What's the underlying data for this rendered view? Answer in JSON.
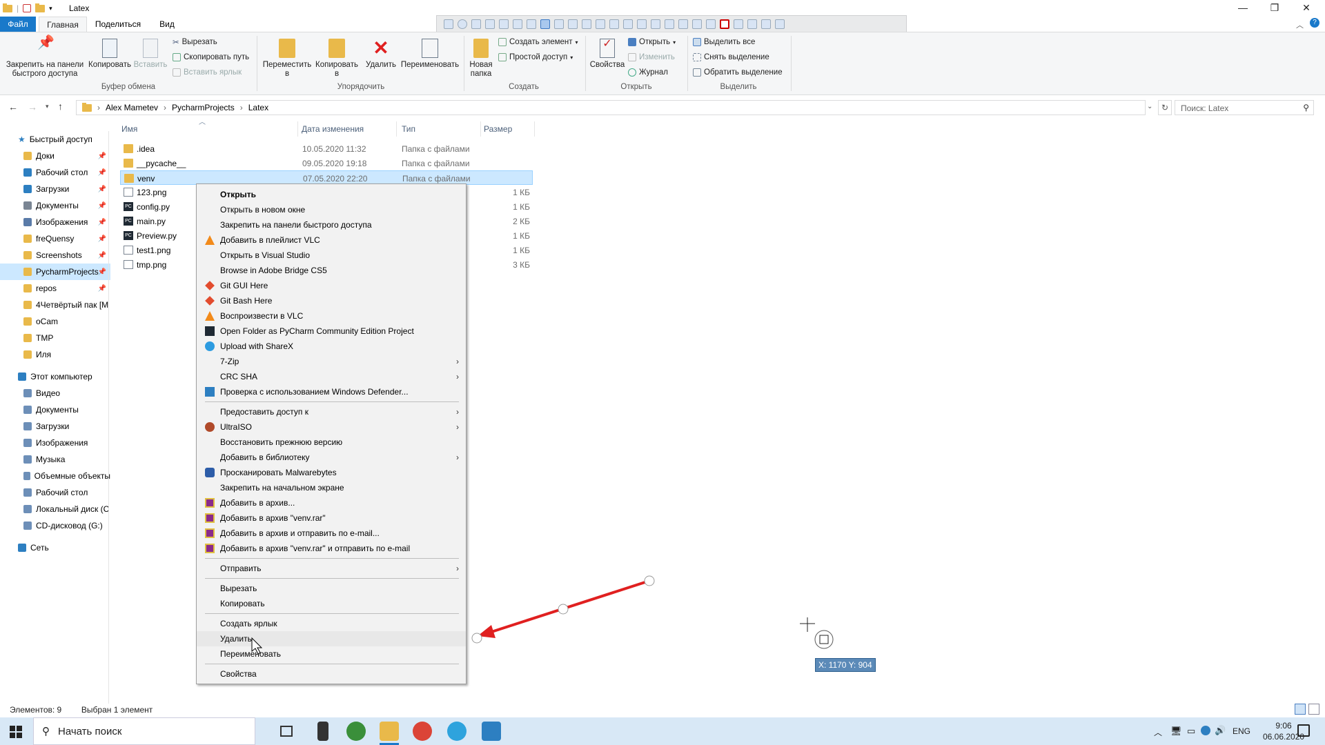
{
  "window": {
    "title": "Latex",
    "minimize": "—",
    "maximize": "❐",
    "close": "✕"
  },
  "ribbon_tabs": {
    "file": "Файл",
    "home": "Главная",
    "share": "Поделиться",
    "view": "Вид"
  },
  "ribbon": {
    "clipboard": {
      "pin": "Закрепить на панели быстрого доступа",
      "copy": "Копировать",
      "paste": "Вставить",
      "cut": "Вырезать",
      "copy_path": "Скопировать путь",
      "paste_shortcut": "Вставить ярлык",
      "group": "Буфер обмена"
    },
    "organize": {
      "move": "Переместить в",
      "copy_to": "Копировать в",
      "delete": "Удалить",
      "rename": "Переименовать",
      "group": "Упорядочить"
    },
    "create": {
      "new_folder": "Новая папка",
      "new_item": "Создать элемент",
      "easy_access": "Простой доступ",
      "group": "Создать"
    },
    "open": {
      "properties": "Свойства",
      "open": "Открыть",
      "edit": "Изменить",
      "history": "Журнал",
      "group": "Открыть"
    },
    "select": {
      "select_all": "Выделить все",
      "select_none": "Снять выделение",
      "invert": "Обратить выделение",
      "group": "Выделить"
    }
  },
  "address": {
    "crumbs": [
      "Alex Mametev",
      "PycharmProjects",
      "Latex"
    ],
    "search_placeholder": "Поиск: Latex"
  },
  "nav": {
    "quick_access": "Быстрый доступ",
    "pinned": [
      {
        "label": "Доки",
        "icon": "docs-icon"
      },
      {
        "label": "Рабочий стол",
        "icon": "desktop-icon"
      },
      {
        "label": "Загрузки",
        "icon": "download-icon"
      },
      {
        "label": "Документы",
        "icon": "documents-icon"
      },
      {
        "label": "Изображения",
        "icon": "pictures-icon"
      },
      {
        "label": "freQuensy",
        "icon": "folder-icon"
      },
      {
        "label": "Screenshots",
        "icon": "folder-icon"
      },
      {
        "label": "PycharmProjects",
        "icon": "folder-icon"
      },
      {
        "label": "repos",
        "icon": "folder-icon"
      }
    ],
    "recent": [
      "4Четвёртый пак [M",
      "oCam",
      "TMP",
      "Иля"
    ],
    "this_pc": "Этот компьютер",
    "pc_items": [
      "Видео",
      "Документы",
      "Загрузки",
      "Изображения",
      "Музыка",
      "Объемные объекты",
      "Рабочий стол",
      "Локальный диск (C",
      "CD-дисковод (G:)"
    ],
    "network": "Сеть"
  },
  "columns": {
    "name": "Имя",
    "date": "Дата изменения",
    "type": "Тип",
    "size": "Размер"
  },
  "files": [
    {
      "name": ".idea",
      "date": "10.05.2020 11:32",
      "type": "Папка с файлами",
      "size": "",
      "kind": "folder"
    },
    {
      "name": "__pycache__",
      "date": "09.05.2020 19:18",
      "type": "Папка с файлами",
      "size": "",
      "kind": "folder"
    },
    {
      "name": "venv",
      "date": "07.05.2020 22:20",
      "type": "Папка с файлами",
      "size": "",
      "kind": "folder"
    },
    {
      "name": "123.png",
      "date": "",
      "type": "",
      "size": "1 КБ",
      "kind": "png"
    },
    {
      "name": "config.py",
      "date": "",
      "type": "",
      "size": "1 КБ",
      "kind": "py"
    },
    {
      "name": "main.py",
      "date": "",
      "type": "",
      "size": "2 КБ",
      "kind": "py"
    },
    {
      "name": "Preview.py",
      "date": "",
      "type": "",
      "size": "1 КБ",
      "kind": "py"
    },
    {
      "name": "test1.png",
      "date": "",
      "type": "",
      "size": "1 КБ",
      "kind": "png"
    },
    {
      "name": "tmp.png",
      "date": "",
      "type": "",
      "size": "3 КБ",
      "kind": "png"
    }
  ],
  "context_menu": [
    {
      "label": "Открыть",
      "bold": true
    },
    {
      "label": "Открыть в новом окне"
    },
    {
      "label": "Закрепить на панели быстрого доступа"
    },
    {
      "label": "Добавить в плейлист VLC",
      "icon": "vlc-icon"
    },
    {
      "label": "Открыть в Visual Studio"
    },
    {
      "label": "Browse in Adobe Bridge CS5"
    },
    {
      "label": "Git GUI Here",
      "icon": "git-icon"
    },
    {
      "label": "Git Bash Here",
      "icon": "git-icon"
    },
    {
      "label": "Воспроизвести в VLC",
      "icon": "vlc-icon"
    },
    {
      "label": "Open Folder as PyCharm Community Edition Project",
      "icon": "pycharm-icon"
    },
    {
      "label": "Upload with ShareX",
      "icon": "sharex-icon"
    },
    {
      "label": "7-Zip",
      "sub": true
    },
    {
      "label": "CRC SHA",
      "sub": true
    },
    {
      "label": "Проверка с использованием Windows Defender...",
      "icon": "defender-icon"
    },
    {
      "sep": true
    },
    {
      "label": "Предоставить доступ к",
      "sub": true
    },
    {
      "label": "UltraISO",
      "icon": "ultraiso-icon",
      "sub": true
    },
    {
      "label": "Восстановить прежнюю версию"
    },
    {
      "label": "Добавить в библиотеку",
      "sub": true
    },
    {
      "label": "Просканировать Malwarebytes",
      "icon": "malwarebytes-icon"
    },
    {
      "label": "Закрепить на начальном экране"
    },
    {
      "label": "Добавить в архив...",
      "icon": "winrar-icon"
    },
    {
      "label": "Добавить в архив \"venv.rar\"",
      "icon": "winrar-icon"
    },
    {
      "label": "Добавить в архив и отправить по e-mail...",
      "icon": "winrar-icon"
    },
    {
      "label": "Добавить в архив \"venv.rar\" и отправить по e-mail",
      "icon": "winrar-icon"
    },
    {
      "sep": true
    },
    {
      "label": "Отправить",
      "sub": true
    },
    {
      "sep": true
    },
    {
      "label": "Вырезать"
    },
    {
      "label": "Копировать"
    },
    {
      "sep": true
    },
    {
      "label": "Создать ярлык"
    },
    {
      "label": "Удалить",
      "highlight": true
    },
    {
      "label": "Переименовать"
    },
    {
      "sep": true
    },
    {
      "label": "Свойства"
    }
  ],
  "status": {
    "count": "Элементов: 9",
    "selected": "Выбран 1 элемент"
  },
  "overlay": {
    "coords": "X: 1170 Y: 904"
  },
  "taskbar": {
    "search": "Начать поиск",
    "lang": "ENG",
    "time": "9:06",
    "date": "06.06.2020"
  },
  "colors": {
    "accent": "#1979ca",
    "selection": "#cce8ff",
    "arrow": "#e02020"
  }
}
